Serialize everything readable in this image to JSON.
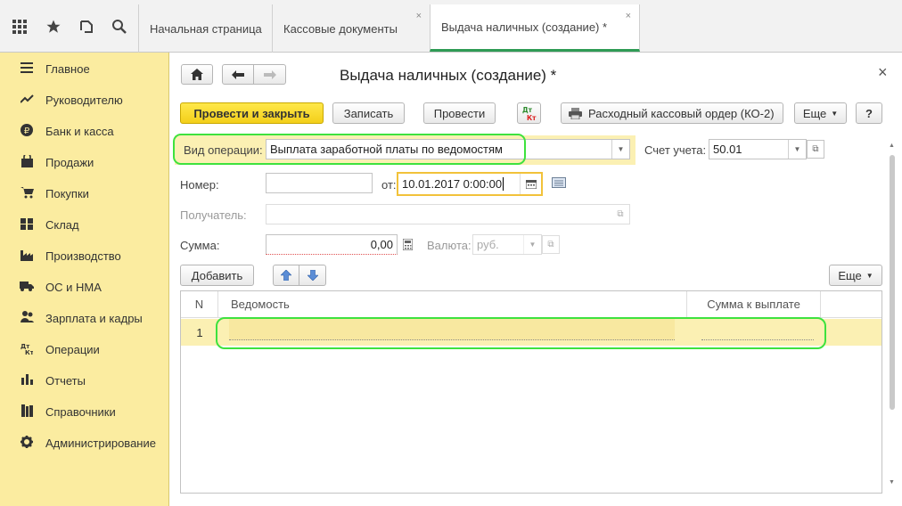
{
  "tabs": [
    {
      "label": "Начальная страница"
    },
    {
      "label": "Кассовые документы",
      "close": "×"
    },
    {
      "label": "Выдача наличных (создание) *",
      "close": "×"
    }
  ],
  "sidebar": {
    "items": [
      {
        "label": "Главное",
        "icon": "menu-icon"
      },
      {
        "label": "Руководителю",
        "icon": "trend-icon"
      },
      {
        "label": "Банк и касса",
        "icon": "ruble-icon"
      },
      {
        "label": "Продажи",
        "icon": "bag-icon"
      },
      {
        "label": "Покупки",
        "icon": "cart-icon"
      },
      {
        "label": "Склад",
        "icon": "grid-icon"
      },
      {
        "label": "Производство",
        "icon": "factory-icon"
      },
      {
        "label": "ОС и НМА",
        "icon": "truck-icon"
      },
      {
        "label": "Зарплата и кадры",
        "icon": "people-icon"
      },
      {
        "label": "Операции",
        "icon": "dt-kt-icon"
      },
      {
        "label": "Отчеты",
        "icon": "bar-chart-icon"
      },
      {
        "label": "Справочники",
        "icon": "books-icon"
      },
      {
        "label": "Администрирование",
        "icon": "gear-icon"
      }
    ]
  },
  "form": {
    "title": "Выдача наличных (создание) *",
    "close": "×",
    "toolbar": {
      "post_close": "Провести и закрыть",
      "save": "Записать",
      "post": "Провести",
      "dt_kt": "Дт Кт",
      "print_order": "Расходный кассовый ордер (КО-2)",
      "more": "Еще",
      "help": "?"
    },
    "operation_label": "Вид операции:",
    "operation_value": "Выплата заработной платы по ведомостям",
    "account_label": "Счет учета:",
    "account_value": "50.01",
    "number_label": "Номер:",
    "number_value": "",
    "date_label": "от:",
    "date_value": "10.01.2017  0:00:00",
    "recipient_label": "Получатель:",
    "recipient_value": "",
    "sum_label": "Сумма:",
    "sum_value": "0,00",
    "currency_label": "Валюта:",
    "currency_value": "руб."
  },
  "table": {
    "add_label": "Добавить",
    "more_label": "Еще",
    "columns": [
      "N",
      "Ведомость",
      "Сумма к выплате"
    ],
    "rows": [
      {
        "n": "1",
        "statement": "",
        "amount": ""
      }
    ]
  },
  "colors": {
    "sidebar_bg": "#fbeca0",
    "primary_button": "#f3cf1a",
    "highlight": "#3ee23e",
    "active_tab": "#2e9b55"
  }
}
